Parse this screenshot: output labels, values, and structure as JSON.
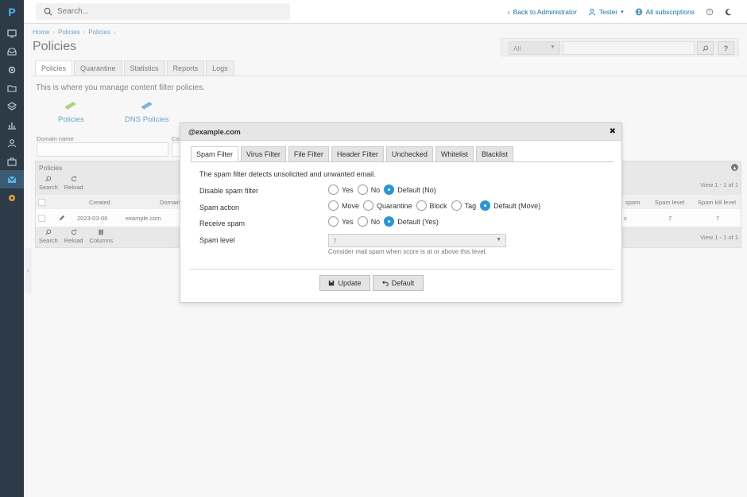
{
  "topbar": {
    "search_placeholder": "Search...",
    "back_link": "Back to Administrator",
    "user": "Tester",
    "subscriptions": "All subscriptions"
  },
  "breadcrumb": [
    "Home",
    "Policies",
    "Policies"
  ],
  "page_title": "Policies",
  "right_search": {
    "scope": "All"
  },
  "tabs": [
    "Policies",
    "Quarantine",
    "Statistics",
    "Reports",
    "Logs"
  ],
  "intro": "This is where you manage content filter policies.",
  "links": {
    "policies": "Policies",
    "dns_policies": "DNS Policies"
  },
  "filters": {
    "domain_name_label": "Domain name",
    "second_label": "Co"
  },
  "grid": {
    "title": "Policies",
    "toolbar_top": [
      "Search",
      "Reload"
    ],
    "toolbar_bottom": [
      "Search",
      "Reload",
      "Columns"
    ],
    "view_count": "View 1 - 1 of 1",
    "headers": {
      "created": "Created",
      "domain": "Domain",
      "spam_partial": "spam",
      "spam_level": "Spam level",
      "spam_kill_level": "Spam kill level"
    },
    "row": {
      "created": "2023-03-06",
      "domain": "example.com",
      "partial": "s",
      "spam_level": "7",
      "spam_kill_level": "7"
    }
  },
  "dialog": {
    "title": "@example.com",
    "tabs": [
      "Spam Filter",
      "Virus Filter",
      "File Filter",
      "Header Filter",
      "Unchecked",
      "Whitelist",
      "Blacklist"
    ],
    "description": "The spam filter detects unsolicited and unwanted email.",
    "fields": {
      "disable": {
        "label": "Disable spam filter",
        "options": [
          "Yes",
          "No",
          "Default (No)"
        ],
        "selected": 2
      },
      "action": {
        "label": "Spam action",
        "options": [
          "Move",
          "Quarantine",
          "Block",
          "Tag",
          "Default (Move)"
        ],
        "selected": 4
      },
      "receive": {
        "label": "Receive spam",
        "options": [
          "Yes",
          "No",
          "Default (Yes)"
        ],
        "selected": 2
      },
      "level": {
        "label": "Spam level",
        "value": "7",
        "hint": "Consider mail spam when score is at or above this level."
      }
    },
    "buttons": {
      "update": "Update",
      "default": "Default"
    }
  }
}
